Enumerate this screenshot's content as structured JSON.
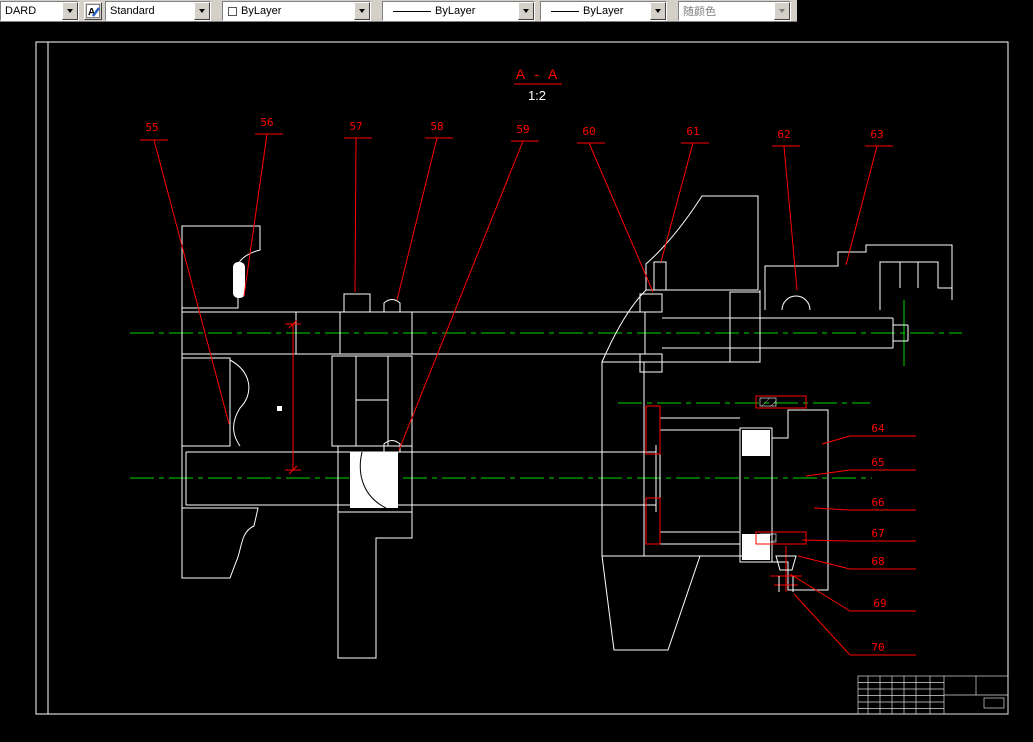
{
  "toolbar": {
    "dim_style": "DARD",
    "text_style": "Standard",
    "color": "ByLayer",
    "linetype": "ByLayer",
    "lineweight": "ByLayer",
    "plot_style": "随颜色"
  },
  "icons": {
    "text_style_glyph": "A"
  },
  "drawing": {
    "section_label": "A - A",
    "scale": "1:2",
    "callouts_top": [
      "55",
      "56",
      "57",
      "58",
      "59",
      "60",
      "61",
      "62",
      "63"
    ],
    "callouts_right": [
      "64",
      "65",
      "66",
      "67",
      "68",
      "69",
      "70"
    ]
  },
  "colors": {
    "leader_red": "#ff0000",
    "centerline_green": "#00d900",
    "geometry_white": "#ffffff",
    "canvas_black": "#000000",
    "toolbar_gray": "#d4d0c8"
  }
}
